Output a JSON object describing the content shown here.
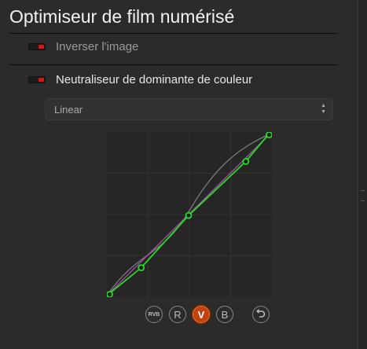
{
  "module": {
    "title": "Optimiseur de film numérisé"
  },
  "options": [
    {
      "label": "Inverser l'image",
      "enabled": false
    },
    {
      "label": "Neutraliseur de dominante de couleur",
      "enabled": true
    }
  ],
  "interpolation": {
    "selected": "Linear"
  },
  "curve": {
    "active_channel": "V",
    "channels": [
      "RVB",
      "R",
      "V",
      "B"
    ],
    "green_points": [
      [
        0.0,
        0.0
      ],
      [
        0.21,
        0.17
      ],
      [
        0.5,
        0.49
      ],
      [
        0.85,
        0.82
      ],
      [
        1.0,
        1.0
      ]
    ],
    "colors": {
      "active": "#22dd22",
      "grid": "#333333",
      "accent": "#c2410c"
    }
  }
}
